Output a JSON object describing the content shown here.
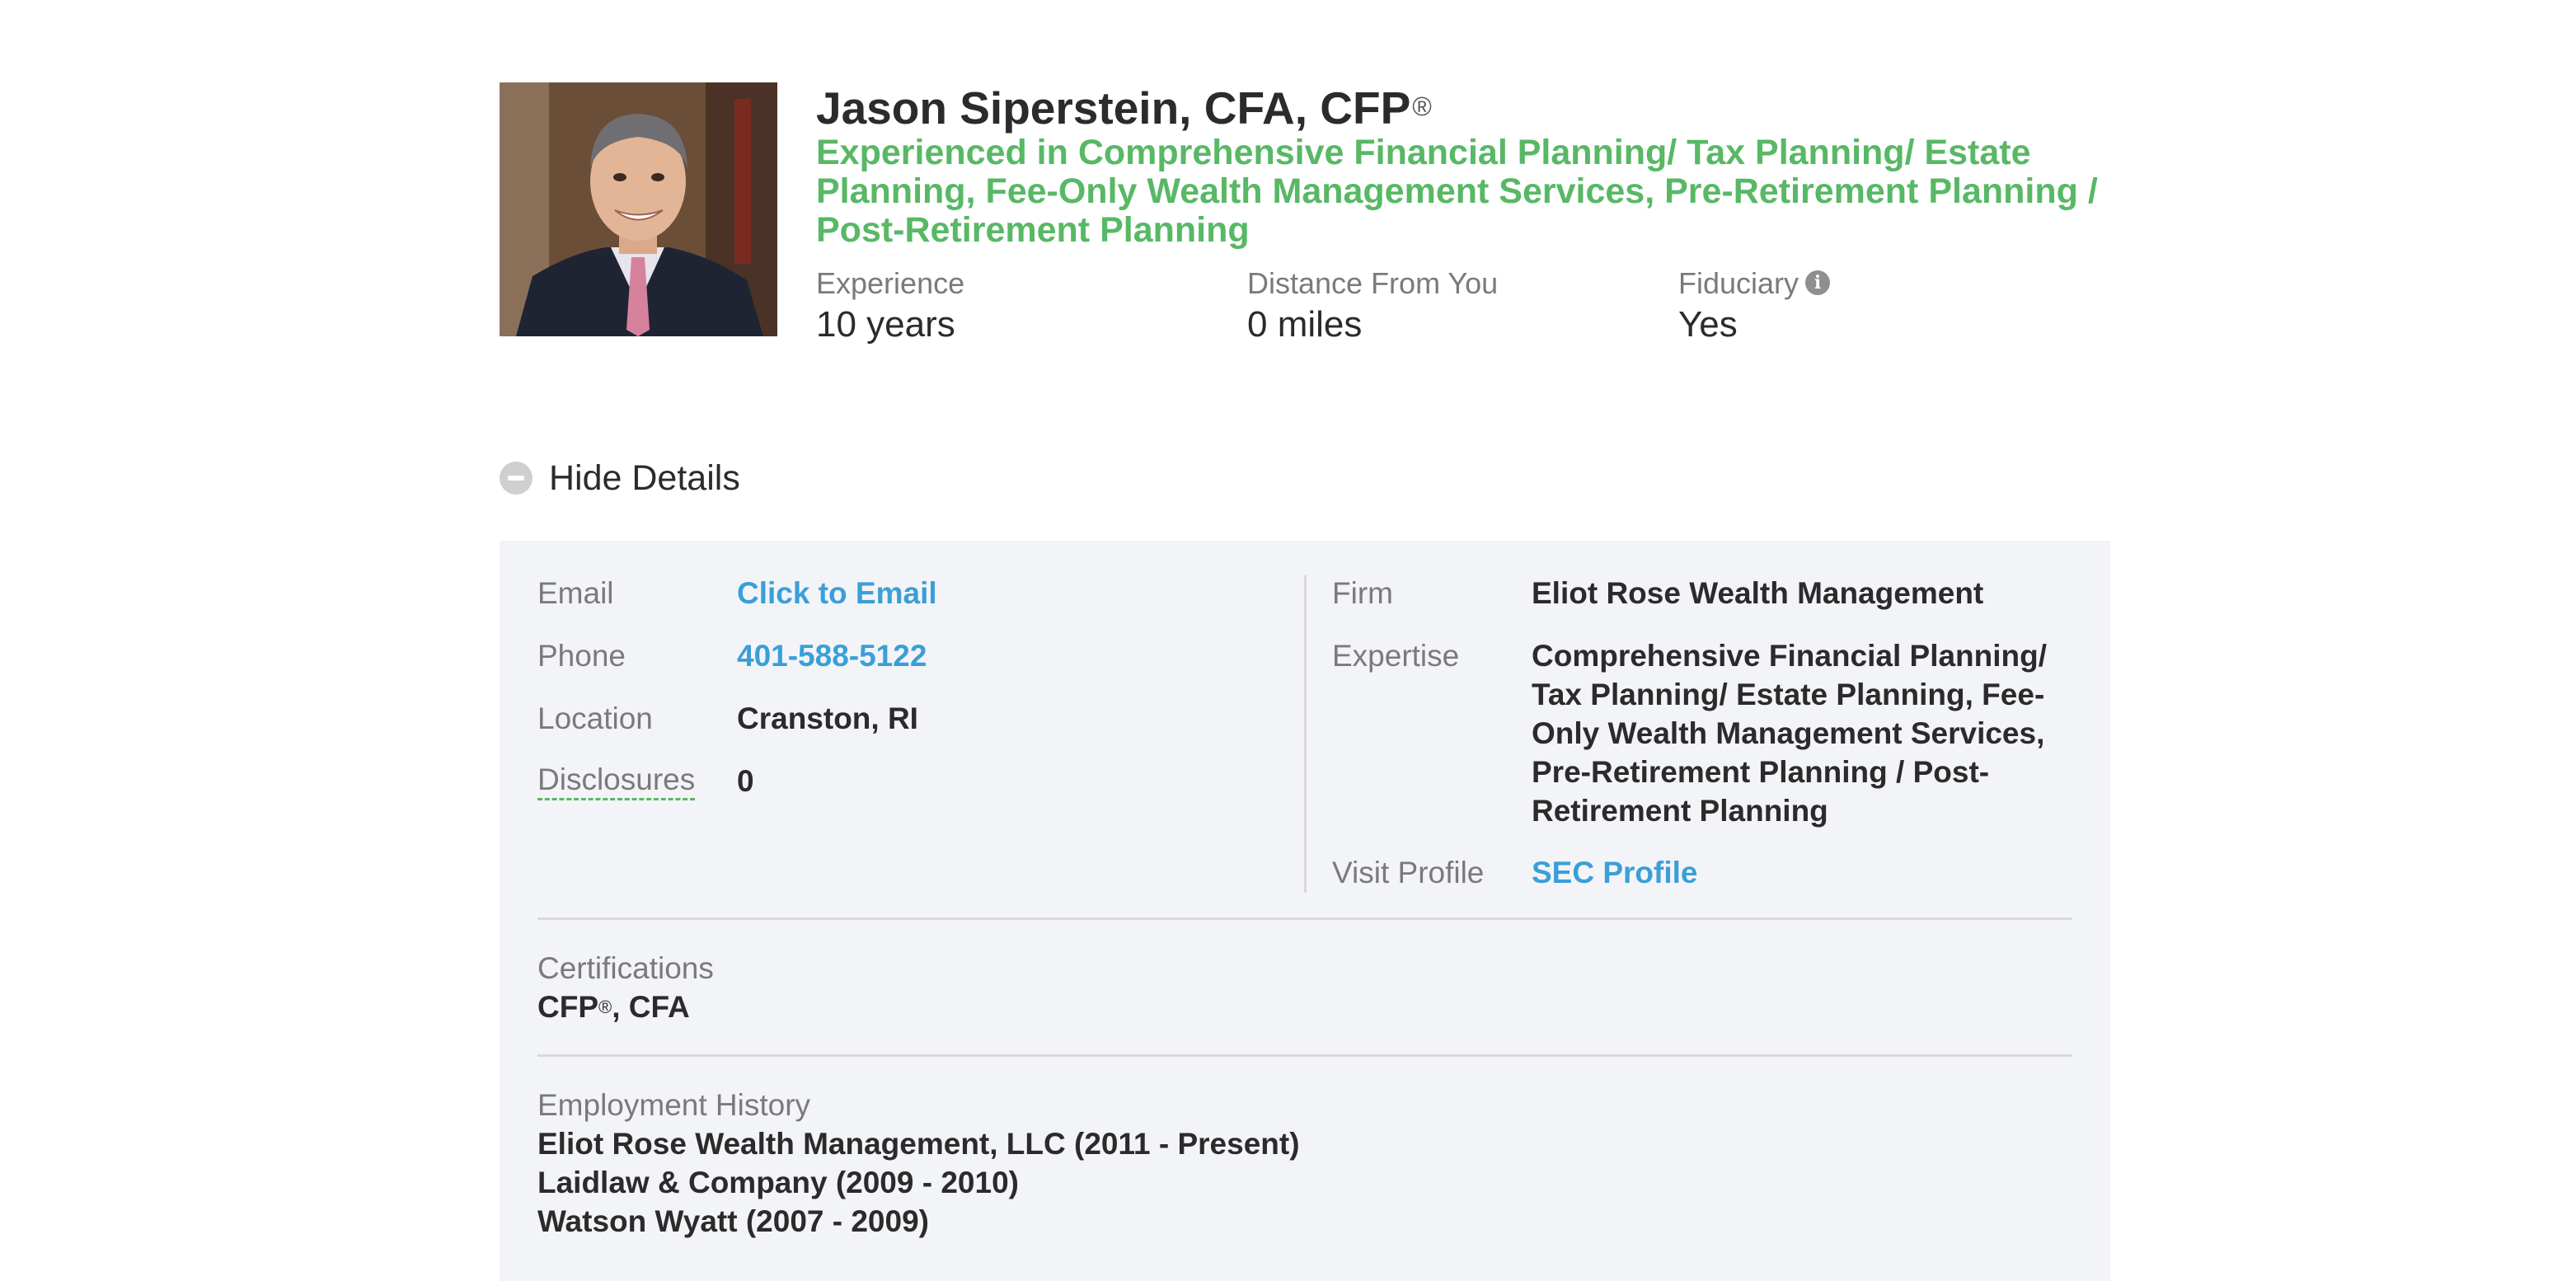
{
  "advisor": {
    "name": "Jason Siperstein, CFA, CFP",
    "name_mark": "®",
    "headline": "Experienced in Comprehensive Financial Planning/ Tax Planning/ Estate Planning, Fee-Only Wealth Management Services, Pre-Retirement Planning / Post-Retirement Planning"
  },
  "stats": {
    "experience": {
      "label": "Experience",
      "value": "10 years"
    },
    "distance": {
      "label": "Distance From You",
      "value": "0 miles"
    },
    "fiduciary": {
      "label": "Fiduciary",
      "value": "Yes",
      "icon": "info-icon"
    }
  },
  "toggle": {
    "label": "Hide Details",
    "icon": "minus-circle-icon"
  },
  "contact": {
    "email": {
      "label": "Email",
      "value": "Click to Email"
    },
    "phone": {
      "label": "Phone",
      "value": "401-588-5122"
    },
    "location": {
      "label": "Location",
      "value": "Cranston, RI"
    },
    "disclosures": {
      "label": "Disclosures",
      "value": "0"
    }
  },
  "firm_info": {
    "firm": {
      "label": "Firm",
      "value": "Eliot Rose Wealth Management"
    },
    "expertise": {
      "label": "Expertise",
      "value": "Comprehensive Financial Planning/ Tax Planning/ Estate Planning, Fee-Only Wealth Management Services, Pre-Retirement Planning / Post-Retirement Planning"
    },
    "visit_profile": {
      "label": "Visit Profile",
      "value": "SEC Profile"
    }
  },
  "certifications": {
    "label": "Certifications",
    "value_prefix": "CFP",
    "value_mark": "®",
    "value_suffix": ", CFA"
  },
  "employment": {
    "label": "Employment History",
    "items": [
      "Eliot Rose Wealth Management, LLC (2011 - Present)",
      "Laidlaw & Company (2009 - 2010)",
      "Watson Wyatt (2007 - 2009)"
    ]
  },
  "colors": {
    "accent_green": "#58b865",
    "link_blue": "#3a9fd8",
    "panel_bg": "#f3f4f7"
  }
}
